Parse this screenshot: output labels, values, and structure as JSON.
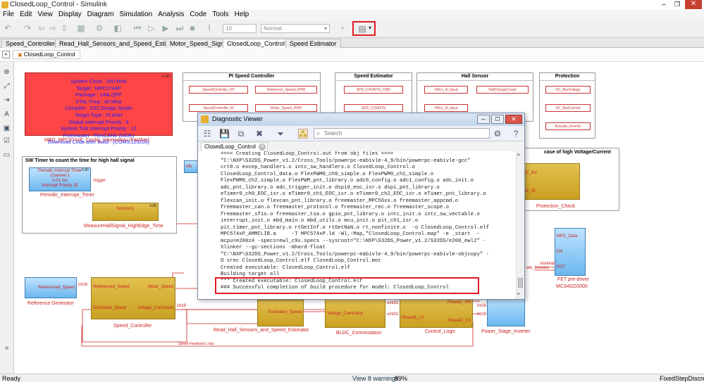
{
  "window": {
    "title": "ClosedLoop_Control - Simulink"
  },
  "menu": [
    "File",
    "Edit",
    "View",
    "Display",
    "Diagram",
    "Simulation",
    "Analysis",
    "Code",
    "Tools",
    "Help"
  ],
  "toolbar": {
    "stop_time": "10",
    "sim_mode": "Normal"
  },
  "tabs": [
    "Speed_Controller",
    "Read_Hall_Sensors_and_Speed_Estimator",
    "Motor_Speed_Sign",
    "ClosedLoop_Control",
    "Speed Estimator"
  ],
  "breadcrumb": "ClosedLoop_Control",
  "config_block": {
    "lines": [
      "System Clock : 200 MHz",
      "Target : MPC5744P",
      "Package : 144LQFP",
      "XTAL Freq : 40 MHz",
      "Compiler : S32 Design Studio",
      "Target Type : FLASH",
      "Global Interrupt Priority : 8",
      "System Tick Interrupt Priority : 12",
      "Freemaster : FlexCAN0 (500K)",
      "Download Code after build : (COM5,115200)"
    ],
    "caption": "MBD_MPC574xP_Config_Information (Panther)",
    "id": "0.183"
  },
  "pi_panel": {
    "title": "PI Speed Controller",
    "items": [
      "SpeedController_KP",
      "Reference_Speed_RPM",
      "SpeedController_KI",
      "Motor_Speed_RPM"
    ],
    "ids": [
      "0.103",
      "0.101",
      "0.106",
      "0.104"
    ]
  },
  "speed_est_panel": {
    "title": "Speed Estimator",
    "items": [
      "SPD_COUNTS_CMD",
      "SPD_COUNTS"
    ],
    "ids": [
      "0.103",
      "0.105"
    ]
  },
  "hall_panel": {
    "title": "Hall Sensor",
    "items": [
      "HALL_A_Input",
      "HallChangeCount",
      "HALL_B_Input"
    ],
    "ids": [
      "0.99",
      "0.98"
    ]
  },
  "protection_panel": {
    "title": "Protection",
    "items": [
      "DC_BusVoltage",
      "DC_BusCurrent",
      "Activate_Inverter"
    ]
  },
  "sw_timer": {
    "title": "SW Timer to count the time for high hall signal",
    "pit_lines": [
      "Periodic Interrupt Timer",
      "Channel 1",
      "0.01 ms",
      "Interrupt Priority 25"
    ],
    "pit_id": "0.86",
    "pit_port": "trigger",
    "pit_caption": "Periodic_Interrupt_Timer",
    "measure_label": "function()",
    "measure_id": "0.85",
    "measure_caption": "MeasureHallSignal_HighEdge_Time",
    "partial": "Mo"
  },
  "protection_area": {
    "title": "case of high Voltage/Current",
    "ports": [
      "DC_BV",
      "DC_BI"
    ],
    "caption": "Protection_Check"
  },
  "blocks": {
    "reference": {
      "port": "Referenced_Speed",
      "caption": "Reference Generator"
    },
    "speed_ctrl": {
      "in1": "Referenced_Speed",
      "in2": "Estimated_Speed",
      "out1": "Motor_Speed",
      "out2": "Voltage_Command",
      "caption": "Speed_Controller"
    },
    "hall_est": {
      "out": "Estimated_Speed",
      "caption": "Read_Hall_Sensors_and_Speed_Estimator"
    },
    "commutation": {
      "in": "Voltage_Command",
      "caption": "BLDC_Commutation"
    },
    "control_logic": {
      "ports": [
        "PhaseC_HS",
        "PhaseB_LS",
        "PhaseC_LS"
      ],
      "caption": "Control_Logic"
    },
    "power_stage": {
      "caption": "Power_Stage_Inverter"
    },
    "fet": {
      "ports": [
        "MPC_Data",
        "EN",
        "RST"
      ],
      "caption1": "FET pre-driver",
      "caption2": "MC34GD3000",
      "partial": "ate_Inverter"
    },
    "feedback_label": "Speed Feedback Loop",
    "signal_labels": [
      "int16",
      "int16",
      "uint32",
      "uint32",
      "int16",
      "int16",
      "boolean"
    ]
  },
  "diag": {
    "title": "Diagnostic Viewer",
    "search_placeholder": "Search",
    "tab": "ClosedLoop_Control",
    "log_lines": [
      "==== Creating ClosedLoop_Control.out from obj files ====",
      "\"C:\\NXP\\S32DS_Power_v1.2/Cross_Tools/powerpc-eabivle-4_9/bin/powerpc-eabivle-gcc\"",
      "crt0.o excep_handlers.o intc_sw_handlers.o ClosedLoop_Control.o",
      "ClosedLoop_Control_data.o FlexPWM0_ch0_simple.o FlexPWM0_ch1_simple.o",
      "FlexPWM0_ch2_simple.o FlexPWM_pnt_library.o adc0_config.o adc1_config.o adc_init.o",
      "adc_pnt_library.o adc_trigger_init.o dspi0_eoc_isr.o dspi_pnt_library.o",
      "eTimer0_ch0_EOC_isr.o eTimer0_ch1_EOC_isr.o eTimer0_ch2_EOC_isr.o eTimer_pnt_library.o",
      "flexcan_init.o flexcan_pnt_library.o freemaster_MPC56xx.o freemaster_appcmd.o",
      "freemaster_can.o freemaster_protocol.o freemaster_rec.o freemaster_scope.o",
      "freemaster_sfio.o freemaster_tsa.o gpio_pnt_library.o intc_init.o intc_sw_vectable.o",
      "interrupt_init.o mbd_main.o mbd_utils.o mcu_init.o pit_ch1_isr.o",
      "pit_timer_pnt_library.o rtGetInf.o rtGetNaN.o rt_nonfinite.o  -o ClosedLoop_Control.elf",
      "MPC574xP_AMMCLIB.a     -T MPC574xP.ld -Wl,-Map,\"ClosedLoop_Control.map\" -e _start  -",
      "mcpu=e200z4 -specs=ewl_c9x.specs --sysroot=\"C:\\NXP\\S32DS_Power_v1.2/S32DS/e200_ewl2\" -",
      "Xlinker --gc-sections -mhard-float",
      "\"C:\\NXP\\S32DS_Power_v1.2/Cross_Tools/powerpc-eabivle-4_9/bin/powerpc-eabivle-objcopy\" -",
      "O srec ClosedLoop_Control.elf ClosedLoop_Control.mot",
      "Created executable: ClosedLoop_Control.elf",
      "Building target all",
      "*** Created executable: ClosedLoop_Control.elf",
      "### Successful completion of build procedure for model: ClosedLoop_Control"
    ]
  },
  "status": {
    "left": "Ready",
    "center": "View 8 warnings",
    "zoom": "89%",
    "right": "FixedStepDiscrete"
  },
  "colors": {
    "highlight": "#e11b22",
    "block_yellow": "#d6b03a",
    "block_blue": "#8ccaf5",
    "config_red": "#ff4040"
  }
}
